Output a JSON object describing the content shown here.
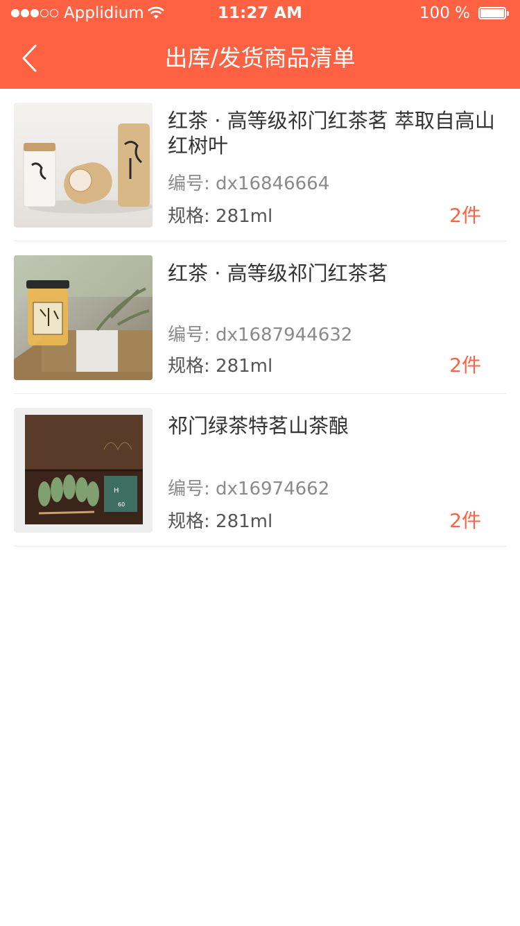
{
  "status": {
    "carrier": "Applidium",
    "time": "11:27 AM",
    "battery": "100 %"
  },
  "header": {
    "title": "出库/发货商品清单"
  },
  "labels": {
    "code_prefix": "编号: ",
    "spec_prefix": "规格: "
  },
  "items": [
    {
      "name": "红茶 · 高等级祁门红茶茗   萃取自高山红树叶",
      "code": "dx16846664",
      "spec": "281ml",
      "qty": "2件"
    },
    {
      "name": "红茶 · 高等级祁门红茶茗",
      "code": "dx1687944632",
      "spec": "281ml",
      "qty": "2件"
    },
    {
      "name": "祁门绿茶特茗山茶酿",
      "code": "dx16974662",
      "spec": "281ml",
      "qty": "2件"
    }
  ],
  "colors": {
    "accent": "#ff6243",
    "text": "#333333",
    "muted": "#8a8a8a"
  }
}
